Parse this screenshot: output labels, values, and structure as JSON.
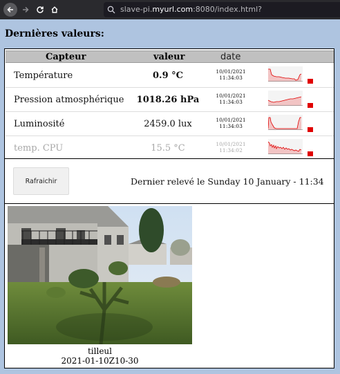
{
  "browser": {
    "url_host_prefix": "slave-pi.",
    "url_host_bold": "myurl.com",
    "url_rest": ":8080/index.html?"
  },
  "page": {
    "heading": "Dernières valeurs:",
    "columns": {
      "sensor": "Capteur",
      "value": "valeur",
      "date": "date"
    },
    "rows": [
      {
        "name": "Température",
        "value": "0.9 °C",
        "date": "10/01/2021",
        "time": "11:34:03"
      },
      {
        "name": "Pression atmosphérique",
        "value": "1018.26 hPa",
        "date": "10/01/2021",
        "time": "11:34:03"
      },
      {
        "name": "Luminosité",
        "value": "2459.0 lux",
        "date": "10/01/2021",
        "time": "11:34:03"
      },
      {
        "name": "temp. CPU",
        "value": "15.5 °C",
        "date": "10/01/2021",
        "time": "11:34:02"
      }
    ],
    "refresh_label": "Rafraichir",
    "last_reading": "Dernier relevé le Sunday 10 January - 11:34",
    "photo": {
      "name": "tilleul",
      "timestamp": "2021-01-10Z10-30"
    }
  },
  "colors": {
    "spark_fill": "#f2c4c4",
    "spark_line": "#e00000",
    "marker": "#e00000",
    "header_bg": "#c0c0c0",
    "page_bg": "#aec4e0"
  }
}
